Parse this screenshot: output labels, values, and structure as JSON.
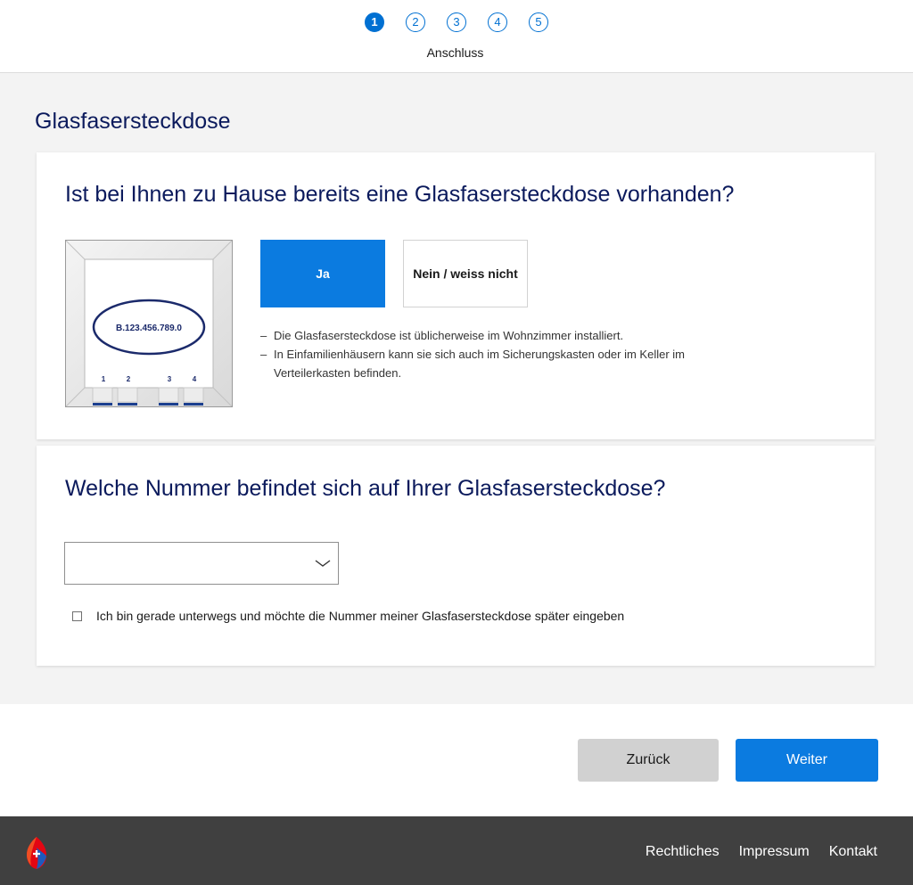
{
  "stepper": {
    "steps": [
      "1",
      "2",
      "3",
      "4",
      "5"
    ],
    "active_label": "Anschluss"
  },
  "page": {
    "title": "Glasfasersteckdose"
  },
  "socket_question": {
    "title": "Ist bei Ihnen zu Hause bereits eine Glasfasersteckdose vorhanden?",
    "illustration": {
      "number": "B.123.456.789.0",
      "ports": [
        "1",
        "2",
        "3",
        "4"
      ]
    },
    "options": {
      "yes": "Ja",
      "no": "Nein / weiss nicht",
      "selected": "yes"
    },
    "hints": [
      "Die Glasfasersteckdose ist üblicherweise im Wohnzimmer installiert.",
      "In Einfamilienhäusern kann sie sich auch im Sicherungskasten oder im Keller im Verteilerkasten befinden."
    ]
  },
  "number_question": {
    "title": "Welche Nummer befindet sich auf Ihrer Glasfasersteckdose?",
    "select_value": "",
    "later_checkbox_label": "Ich bin gerade unterwegs und möchte die Nummer meiner Glasfasersteckdose später eingeben",
    "later_checked": false
  },
  "actions": {
    "back": "Zurück",
    "next": "Weiter"
  },
  "footer": {
    "links": [
      "Rechtliches",
      "Impressum",
      "Kontakt"
    ]
  },
  "colors": {
    "accent": "#0b7be0",
    "navy_text": "#0b1a5c",
    "footer_bg": "#404040",
    "page_bg": "#f3f3f3"
  }
}
